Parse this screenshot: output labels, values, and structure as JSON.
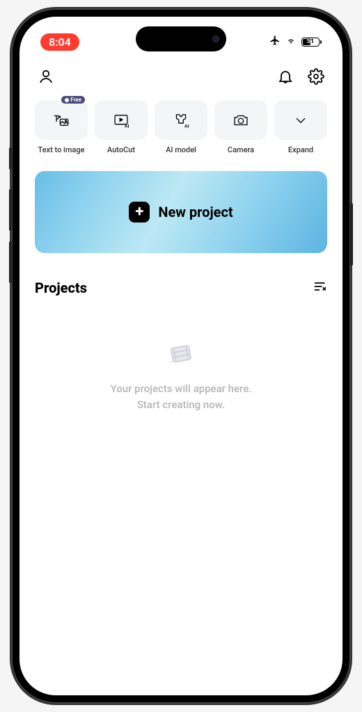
{
  "status": {
    "time": "8:04",
    "battery_pct": "51"
  },
  "tools": [
    {
      "icon": "text-to-image",
      "label": "Text to image",
      "badge": "Free"
    },
    {
      "icon": "autocut",
      "label": "AutoCut",
      "badge": null
    },
    {
      "icon": "ai-model",
      "label": "AI model",
      "badge": null
    },
    {
      "icon": "camera",
      "label": "Camera",
      "badge": null
    },
    {
      "icon": "expand",
      "label": "Expand",
      "badge": null
    }
  ],
  "new_project": {
    "label": "New project"
  },
  "projects": {
    "title": "Projects",
    "empty_line1": "Your projects will appear here.",
    "empty_line2": "Start creating now."
  }
}
